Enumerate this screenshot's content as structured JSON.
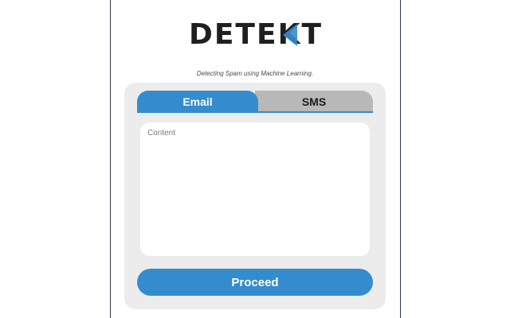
{
  "brand": {
    "logo_prefix": "DETE",
    "logo_k": "K",
    "logo_suffix": "T",
    "tagline": "Detecting Spam using Machine Learning.",
    "accent_color": "#348ccf"
  },
  "tabs": [
    {
      "label": "Email",
      "active": true
    },
    {
      "label": "SMS",
      "active": false
    }
  ],
  "form": {
    "content_placeholder": "Content",
    "content_value": "",
    "proceed_label": "Proceed"
  }
}
